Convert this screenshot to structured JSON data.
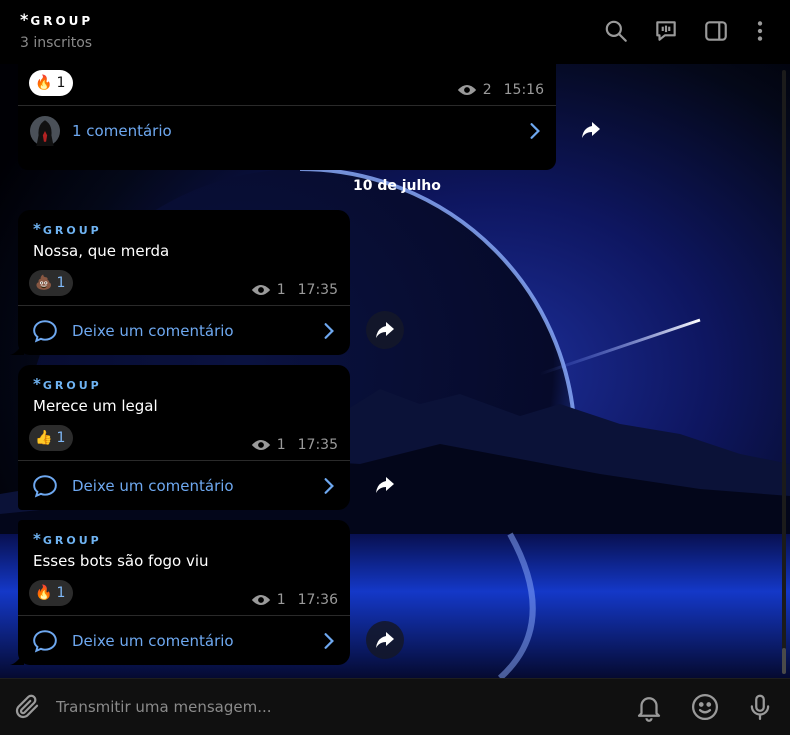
{
  "header": {
    "title_star": "*",
    "title": "GROUP",
    "subtitle": "3 inscritos"
  },
  "date_separator": "10 de julho",
  "messages": [
    {
      "reaction_emoji": "🔥",
      "reaction_count": "1",
      "views": "2",
      "time": "15:16",
      "comment_label": "1 comentário"
    },
    {
      "sender_star": "*",
      "sender": "GROUP",
      "text": "Nossa, que merda",
      "reaction_emoji": "💩",
      "reaction_count": "1",
      "views": "1",
      "time": "17:35",
      "comment_label": "Deixe um comentário"
    },
    {
      "sender_star": "*",
      "sender": "GROUP",
      "text": "Merece um legal",
      "reaction_emoji": "👍",
      "reaction_count": "1",
      "views": "1",
      "time": "17:35",
      "comment_label": "Deixe um comentário"
    },
    {
      "sender_star": "*",
      "sender": "GROUP",
      "text": "Esses bots são fogo viu",
      "reaction_emoji": "🔥",
      "reaction_count": "1",
      "views": "1",
      "time": "17:36",
      "comment_label": "Deixe um comentário"
    }
  ],
  "composer": {
    "placeholder": "Transmitir uma mensagem..."
  },
  "colors": {
    "accent": "#6ea8f0",
    "sender": "#6fb3f2",
    "bubble": "#000000",
    "meta": "#9a9a9a"
  }
}
